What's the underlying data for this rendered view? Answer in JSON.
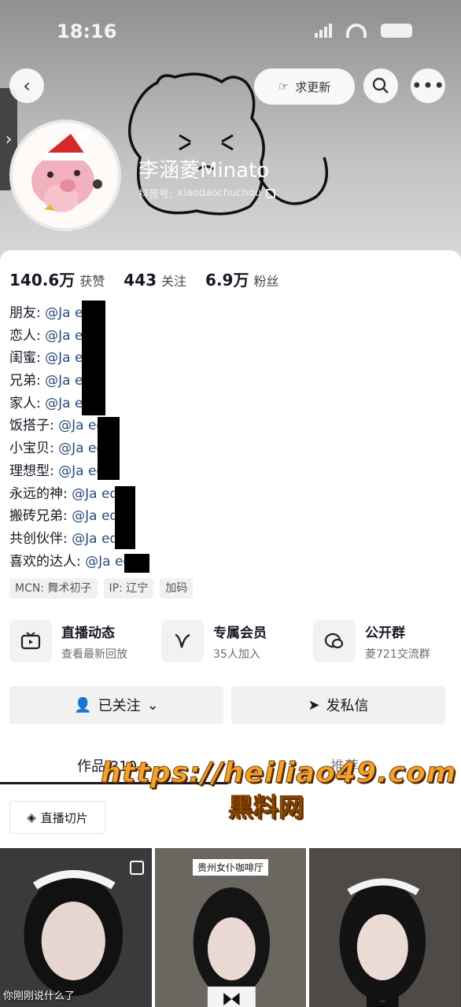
{
  "status_bar": {
    "time": "18:16"
  },
  "header": {
    "update_label": "求更新",
    "username": "李涵菱Minato",
    "account_label": "抖音号:",
    "account_id": "xiaodaochuchou"
  },
  "stats": [
    {
      "value": "140.6万",
      "label": "获赞"
    },
    {
      "value": "443",
      "label": "关注"
    },
    {
      "value": "6.9万",
      "label": "粉丝"
    }
  ],
  "relations": [
    {
      "label": "朋友: ",
      "handle": "@Ja    ed"
    },
    {
      "label": "恋人: ",
      "handle": "@Ja    ed"
    },
    {
      "label": "闺蜜: ",
      "handle": "@Ja    ed"
    },
    {
      "label": "兄弟: ",
      "handle": "@Ja    ed"
    },
    {
      "label": "家人: ",
      "handle": "@Ja    ed"
    },
    {
      "label": "饭搭子: ",
      "handle": "@Ja    ed"
    },
    {
      "label": "小宝贝: ",
      "handle": "@Ja    ed"
    },
    {
      "label": "理想型: ",
      "handle": "@Ja    ed"
    },
    {
      "label": "永远的神: ",
      "handle": "@Ja    ed"
    },
    {
      "label": "搬砖兄弟: ",
      "handle": "@Ja    ed"
    },
    {
      "label": "共创伙伴: ",
      "handle": "@Ja    ed"
    },
    {
      "label": "喜欢的达人: ",
      "handle": "@Ja    ed"
    }
  ],
  "tags": [
    "MCN: 舞术初子",
    "IP: 辽宁",
    "加码"
  ],
  "features": [
    {
      "icon": "tv-icon",
      "title": "直播动态",
      "subtitle": "查看最新回放"
    },
    {
      "icon": "v-icon",
      "title": "专属会员",
      "subtitle": "35人加入"
    },
    {
      "icon": "chat-group-icon",
      "title": "公开群",
      "subtitle": "菱721交流群"
    }
  ],
  "actions": {
    "follow": "已关注",
    "message": "发私信"
  },
  "tabs": {
    "works": "作品 310",
    "recommend": "推荐"
  },
  "live_clip": "直播切片",
  "watermark": {
    "url": "https://heiliao49.com",
    "name": "黑料网"
  },
  "thumbnails": [
    {
      "caption": "",
      "text": "你刚刚说什么了"
    },
    {
      "caption": "贵州女仆咖啡厅",
      "text": ""
    },
    {
      "caption": "",
      "text": ""
    }
  ],
  "colors": {
    "handle": "#2b4a7b",
    "watermark": "#f3a32c",
    "header_gray": "#a9a9a9"
  }
}
